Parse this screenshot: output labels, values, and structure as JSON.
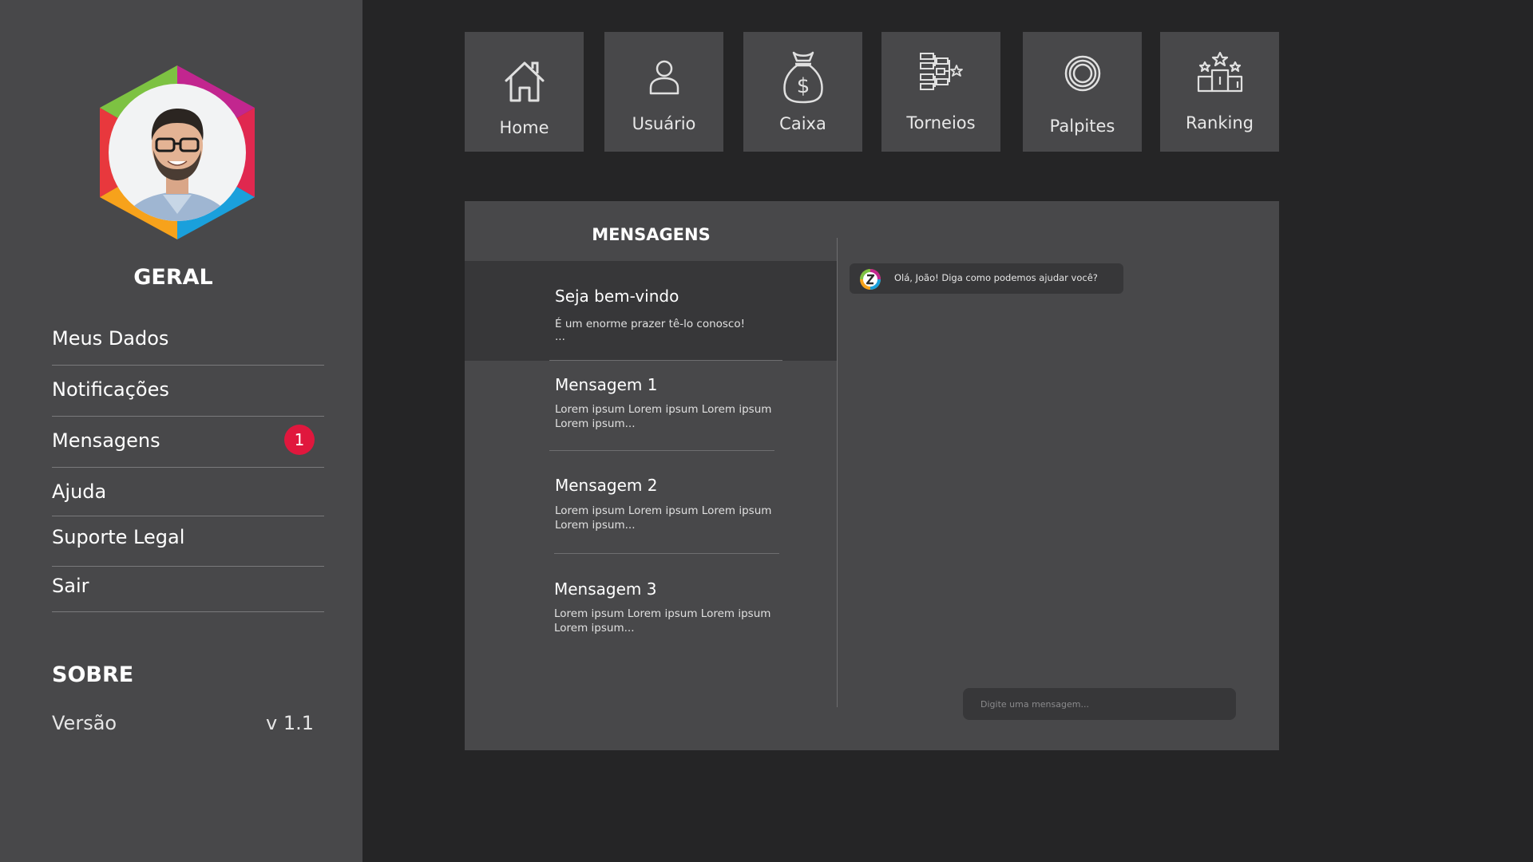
{
  "sidebar": {
    "geral_title": "GERAL",
    "menu": [
      {
        "label": "Meus Dados"
      },
      {
        "label": "Notificações"
      },
      {
        "label": "Mensagens",
        "badge": "1"
      },
      {
        "label": "Ajuda"
      },
      {
        "label": "Suporte Legal"
      },
      {
        "label": "Sair"
      }
    ],
    "sobre_title": "SOBRE",
    "version_label": "Versão",
    "version_value": "v 1.1"
  },
  "nav": {
    "tiles": [
      {
        "label": "Home",
        "icon": "home-icon"
      },
      {
        "label": "Usuário",
        "icon": "user-icon"
      },
      {
        "label": "Caixa",
        "icon": "money-bag-icon"
      },
      {
        "label": "Torneios",
        "icon": "bracket-icon"
      },
      {
        "label": "Palpites",
        "icon": "target-icon"
      },
      {
        "label": "Ranking",
        "icon": "podium-icon"
      }
    ]
  },
  "messages": {
    "title": "MENSAGENS",
    "items": [
      {
        "title": "Seja bem-vindo",
        "body": "É um enorme prazer tê-lo conosco!",
        "more": "..."
      },
      {
        "title": "Mensagem 1",
        "body": "Lorem ipsum Lorem ipsum Lorem ipsum Lorem ipsum..."
      },
      {
        "title": "Mensagem 2",
        "body": "Lorem ipsum Lorem ipsum Lorem ipsum Lorem ipsum..."
      },
      {
        "title": "Mensagem 3",
        "body": "Lorem ipsum Lorem ipsum Lorem ipsum Lorem ipsum..."
      }
    ]
  },
  "chat": {
    "bot_message": "Olá, João! Diga como podemos ajudar você?",
    "input_placeholder": "Digite uma mensagem..."
  },
  "colors": {
    "background": "#252526",
    "panel": "#48484a",
    "active_item": "#373739",
    "badge": "#e0173d",
    "hex_green": "#7dc242",
    "hex_magenta": "#c2268f",
    "hex_pink": "#e0284f",
    "hex_blue": "#1aa0dc",
    "hex_orange": "#f7a21b",
    "hex_red": "#e8383d"
  }
}
